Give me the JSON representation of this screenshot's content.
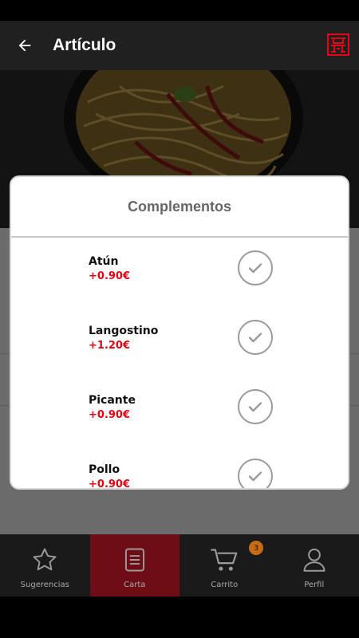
{
  "app_bar": {
    "title": "Artículo",
    "back_icon": "arrow-left-icon",
    "logo_icon": "restaurant-logo-icon",
    "logo_color": "#e30613"
  },
  "dialog": {
    "title": "Complementos",
    "options": [
      {
        "name": "Atún",
        "price": "+0.90€"
      },
      {
        "name": "Langostino",
        "price": "+1.20€"
      },
      {
        "name": "Picante",
        "price": "+0.90€"
      },
      {
        "name": "Pollo",
        "price": "+0.90€"
      }
    ],
    "price_color": "#e30613",
    "check_icon": "checkmark-circle-icon"
  },
  "bottom_nav": {
    "items": [
      {
        "label": "Sugerencias",
        "icon": "star-icon"
      },
      {
        "label": "Carta",
        "icon": "menu-document-icon",
        "active": true
      },
      {
        "label": "Carrito",
        "icon": "cart-icon"
      },
      {
        "label": "Perfil",
        "icon": "user-icon"
      }
    ],
    "cart_badge": "3",
    "active_color": "#6e0d16",
    "badge_color": "#c76b14"
  }
}
